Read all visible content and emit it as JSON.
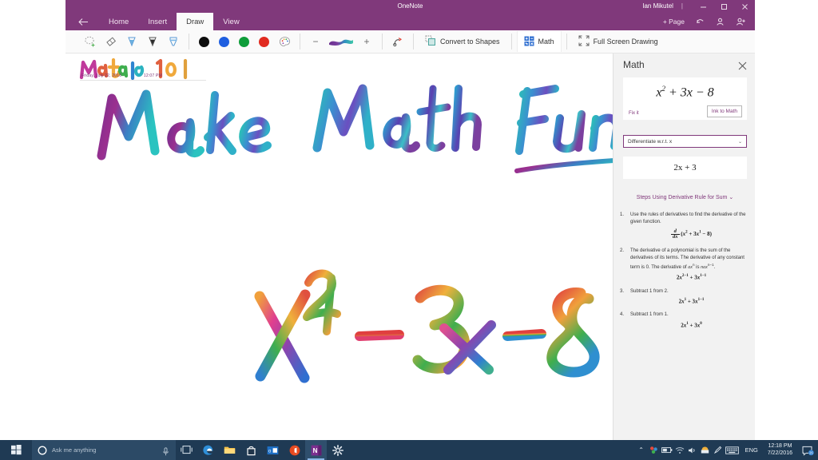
{
  "window": {
    "title": "OneNote",
    "user": "Ian Mikutel",
    "separator": "|",
    "minimize_label": "Minimize",
    "restore_label": "Restore",
    "close_label": "Close"
  },
  "ribbon": {
    "back_label": "Back",
    "tabs": [
      {
        "label": "Home",
        "active": false
      },
      {
        "label": "Insert",
        "active": false
      },
      {
        "label": "Draw",
        "active": true
      },
      {
        "label": "View",
        "active": false
      }
    ],
    "page_controls": [
      {
        "label": "+ Page",
        "name": "add-page-button"
      },
      {
        "label": "",
        "name": "undo-button"
      },
      {
        "label": "",
        "name": "share-user-button"
      },
      {
        "label": "",
        "name": "add-user-button"
      }
    ]
  },
  "toolbar": {
    "tools": [
      {
        "name": "lasso-select-icon",
        "label": "Lasso Select"
      },
      {
        "name": "eraser-icon",
        "label": "Eraser"
      },
      {
        "name": "pen-icon",
        "label": "Pen"
      },
      {
        "name": "pencil-icon",
        "label": "Pencil"
      },
      {
        "name": "highlighter-icon",
        "label": "Highlighter"
      }
    ],
    "colors": [
      {
        "name": "color-black",
        "hex": "#0d0d0d"
      },
      {
        "name": "color-blue",
        "hex": "#1f5fe0"
      },
      {
        "name": "color-green",
        "hex": "#0f9d3a"
      },
      {
        "name": "color-red",
        "hex": "#e12b20"
      }
    ],
    "palette_label": "More Colors",
    "thickness_decrease": "−",
    "thickness_increase": "+",
    "ink_preview_label": "Galaxy Ink",
    "buttons": [
      {
        "label": "Convert to Shapes",
        "name": "convert-to-shapes-button",
        "active": false
      },
      {
        "label": "Math",
        "name": "math-button",
        "active": true
      },
      {
        "label": "Full Screen Drawing",
        "name": "full-screen-drawing-button",
        "active": false
      }
    ]
  },
  "note": {
    "title_ink": "Math 101",
    "date": "Friday, July 22, 2016",
    "time": "12:07 PM",
    "ink_headline": "Make Math Fun!",
    "ink_equation": "x² + 3x - 8"
  },
  "math_pane": {
    "title": "Math",
    "close_label": "Close",
    "equation": {
      "base": "x",
      "exp": "2",
      "rest": "+ 3x − 8"
    },
    "equation_text": "x² + 3x − 8",
    "fix_it_label": "Fix it",
    "ink_to_math_label": "Ink to Math",
    "action_select": {
      "value": "Differentiate w.r.t. x",
      "caret": "⌄"
    },
    "answer": "2x + 3",
    "steps_header": "Steps Using Derivative Rule for Sum ⌄",
    "steps": [
      {
        "n": "1.",
        "text": "Use the rules of derivatives to find the derivative of the given function.",
        "math": "d/dx (x² + 3x¹ − 8)"
      },
      {
        "n": "2.",
        "text": "The derivative of a polynomial is the sum of the derivatives of its terms. The derivative of any constant term is 0. The derivative of axⁿ is naxⁿ⁻¹.",
        "math": "2x²⁻¹ + 3x¹⁻¹"
      },
      {
        "n": "3.",
        "text": "Subtract 1 from 2.",
        "math": "2x¹ + 3x¹⁻¹"
      },
      {
        "n": "4.",
        "text": "Subtract 1 from 1.",
        "math": "2x¹ + 3x⁰"
      }
    ]
  },
  "taskbar": {
    "start_label": "Start",
    "search_placeholder": "Ask me anything",
    "mic_label": "Microphone",
    "apps": [
      {
        "name": "task-view-icon",
        "label": "Task View"
      },
      {
        "name": "edge-icon",
        "label": "Microsoft Edge"
      },
      {
        "name": "file-explorer-icon",
        "label": "File Explorer"
      },
      {
        "name": "store-icon",
        "label": "Store"
      },
      {
        "name": "mail-icon",
        "label": "Mail"
      },
      {
        "name": "office-icon",
        "label": "Office"
      },
      {
        "name": "onenote-icon",
        "label": "OneNote"
      },
      {
        "name": "settings-icon",
        "label": "Settings"
      }
    ],
    "tray": {
      "chevron": "⌃",
      "language": "ENG",
      "time": "12:18 PM",
      "date": "7/22/2016",
      "notification_count": "26"
    }
  },
  "colors": {
    "ribbon_purple": "#80397b",
    "panel_gray": "#f2f2f2",
    "taskbar_blue": "#1f3a54",
    "accent_link": "#80397b"
  }
}
